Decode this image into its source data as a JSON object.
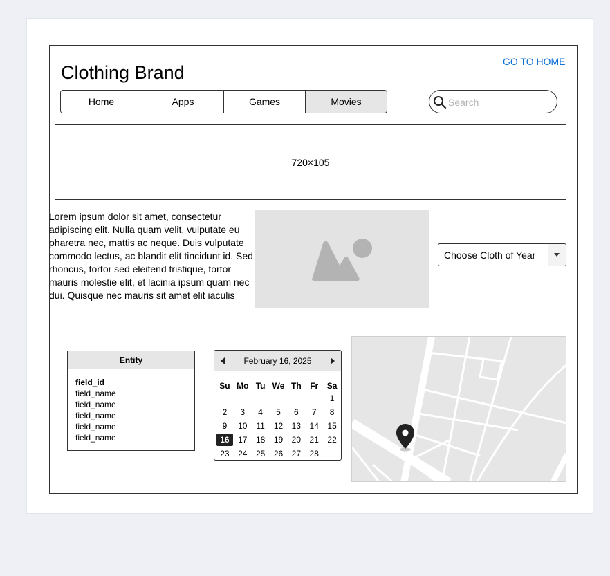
{
  "header": {
    "brand": "Clothing Brand",
    "home_link": "GO TO HOME"
  },
  "nav": {
    "tabs": [
      {
        "label": "Home",
        "active": false
      },
      {
        "label": "Apps",
        "active": false
      },
      {
        "label": "Games",
        "active": false
      },
      {
        "label": "Movies",
        "active": true
      }
    ]
  },
  "search": {
    "placeholder": "Search",
    "icon": "search-icon"
  },
  "banner": {
    "label": "720×105"
  },
  "content": {
    "lorem_lines": [
      "Lorem ipsum dolor sit amet, consectetur",
      "adipiscing elit. Nulla quam velit, vulputate eu",
      "pharetra nec, mattis ac neque. Duis vulputate",
      "commodo lectus, ac blandit elit tincidunt id. Sed",
      "rhoncus, tortor sed eleifend tristique, tortor",
      "mauris molestie elit, et lacinia ipsum quam nec",
      "dui. Quisque nec mauris sit amet elit iaculis"
    ],
    "image_icon": "image-placeholder-icon"
  },
  "dropdown": {
    "selected": "Choose Cloth of Year",
    "icon": "chevron-down-icon"
  },
  "entity": {
    "title": "Entity",
    "fields": [
      "field_id",
      "field_name",
      "field_name",
      "field_name",
      "field_name",
      "field_name"
    ]
  },
  "calendar": {
    "title": "February 16, 2025",
    "weekdays": [
      "Su",
      "Mo",
      "Tu",
      "We",
      "Th",
      "Fr",
      "Sa"
    ],
    "leading_blanks": 6,
    "days": [
      1,
      2,
      3,
      4,
      5,
      6,
      7,
      8,
      9,
      10,
      11,
      12,
      13,
      14,
      15,
      16,
      17,
      18,
      19,
      20,
      21,
      22,
      23,
      24,
      25,
      26,
      27,
      28
    ],
    "selected_day": 16
  },
  "map": {
    "marker_icon": "map-pin-icon"
  },
  "colors": {
    "link": "#0b6fd4",
    "active_tab": "#e6e6e6",
    "placeholder_fill": "#e3e3e3",
    "placeholder_shape": "#b3b3b3"
  }
}
